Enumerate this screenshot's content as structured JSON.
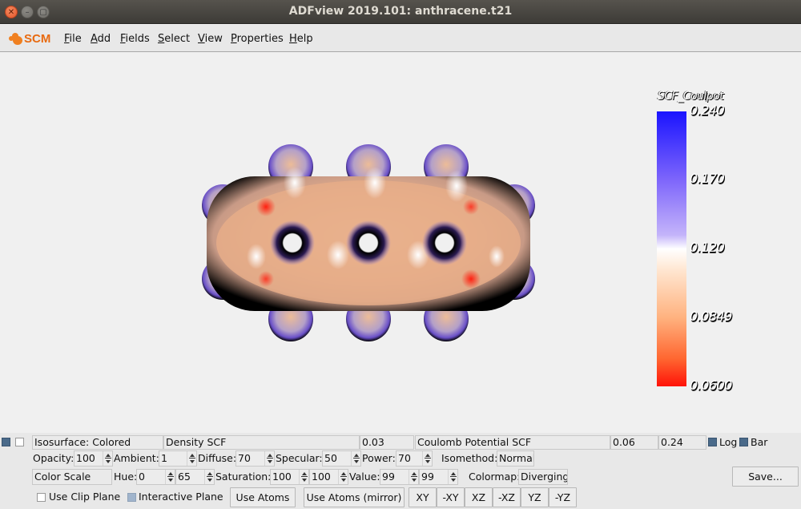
{
  "window": {
    "title": "ADFview 2019.101: anthracene.t21",
    "controls": [
      "close",
      "minimize",
      "maximize"
    ]
  },
  "menubar": {
    "logo": "SCM",
    "items": [
      {
        "label": "File",
        "mnemonic": "F"
      },
      {
        "label": "Add",
        "mnemonic": "A"
      },
      {
        "label": "Fields",
        "mnemonic": "F"
      },
      {
        "label": "Select",
        "mnemonic": "S"
      },
      {
        "label": "View",
        "mnemonic": "V"
      },
      {
        "label": "Properties",
        "mnemonic": "P"
      },
      {
        "label": "Help",
        "mnemonic": "H"
      }
    ]
  },
  "viewport": {
    "molecule": "anthracene",
    "colorbar": {
      "title": "SCF_Coulpot",
      "ticks": [
        "0.240",
        "0.170",
        "0.120",
        "0.0849",
        "0.0600"
      ],
      "colors": {
        "top": "#1a14ff",
        "middle": "#ffffff",
        "bottom": "#ff1208"
      }
    }
  },
  "panel": {
    "row1": {
      "visible_checked": true,
      "second_checked": false,
      "type": "Isosurface: Colored",
      "field": "Density SCF",
      "isovalue": "0.03",
      "color_field": "Coulomb Potential SCF",
      "min": "0.06",
      "max": "0.24",
      "log_label": "Log",
      "log_checked": true,
      "bar_label": "Bar",
      "bar_checked": true
    },
    "row2": {
      "opacity_label": "Opacity:",
      "opacity": "100",
      "ambient_label": "Ambient:",
      "ambient": "1",
      "diffuse_label": "Diffuse:",
      "diffuse": "70",
      "specular_label": "Specular:",
      "specular": "50",
      "power_label": "Power:",
      "power": "70",
      "isomethod_label": "Isomethod:",
      "isomethod": "Normal"
    },
    "row3": {
      "scale": "Color Scale",
      "hue_label": "Hue:",
      "hue_min": "0",
      "hue_max": "65",
      "saturation_label": "Saturation:",
      "sat_min": "100",
      "sat_max": "100",
      "value_label": "Value:",
      "val_min": "99",
      "val_max": "99",
      "colormap_label": "Colormap:",
      "colormap": "Diverging",
      "save_label": "Save..."
    },
    "row4": {
      "clip_label": "Use Clip Plane",
      "clip_checked": false,
      "interactive_label": "Interactive Plane",
      "interactive_checked": true,
      "use_atoms": "Use Atoms",
      "use_atoms_mirror": "Use Atoms (mirror)",
      "planes": [
        "XY",
        "-XY",
        "XZ",
        "-XZ",
        "YZ",
        "-YZ"
      ]
    }
  }
}
